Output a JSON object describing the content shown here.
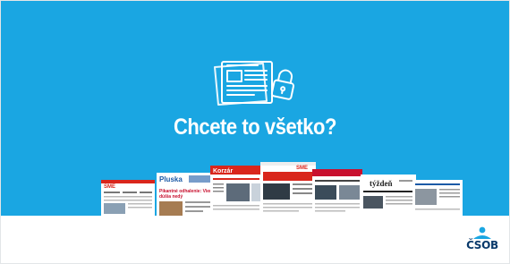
{
  "banner": {
    "headline": "Chcete to všetko?",
    "background_color": "#1aa6e2",
    "illustration_icons": [
      "newspaper-icon",
      "padlock-icon"
    ]
  },
  "newspapers": [
    {
      "masthead": "SME",
      "accent": "#d9261c"
    },
    {
      "masthead": "Pluska",
      "headline": "Pikantné odhalenie: Vieme, ktorí",
      "headline2": "dúšia nedý",
      "accent": "#1c5aa6"
    },
    {
      "masthead": "Korzár",
      "accent": "#d9261c"
    },
    {
      "masthead": "SME",
      "accent": "#d9261c"
    },
    {
      "masthead": "Pravda",
      "accent": "#c8102e"
    },
    {
      "masthead": "týždeň",
      "accent": "#222222"
    },
    {
      "masthead": "",
      "accent": "#1c5aa6"
    }
  ],
  "footer": {
    "logo_text": "ČSOB",
    "logo_color": "#0a3a6b",
    "logo_accent": "#1aa6e2"
  }
}
